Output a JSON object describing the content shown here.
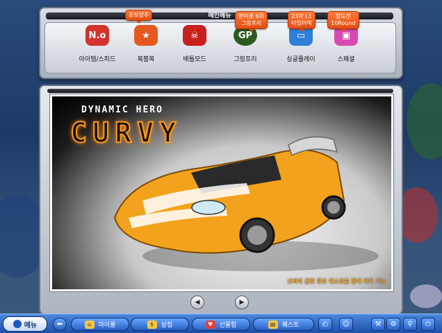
{
  "menu": {
    "title": "메인메뉴",
    "modes": [
      {
        "label": "아이템/스피드",
        "icon": "no-sign-icon",
        "color": "#d2342c"
      },
      {
        "label": "복불복",
        "icon": "pinata-icon",
        "color": "#e45a1e"
      },
      {
        "label": "배틀모드",
        "icon": "pirate-icon",
        "color": "#c7201e"
      },
      {
        "label": "그랑프리",
        "icon": "gp-badge-icon",
        "color": "#2d5a1e"
      },
      {
        "label": "싱글플레이",
        "icon": "monitor-icon",
        "color": "#2f80d8"
      },
      {
        "label": "스페셜",
        "icon": "tv-icon",
        "color": "#d94ab0"
      }
    ],
    "callouts": [
      {
        "text": "초보강추"
      },
      {
        "text": "변이롯 6차\n그랑프리"
      },
      {
        "text": "23차 L1\n타임어택"
      },
      {
        "text": "컬도전\n10Round"
      }
    ]
  },
  "poster": {
    "subtitle": "DYNAMIC HERO",
    "name": "CURVY",
    "caption": "신비의 금빛 큐브 퀘스트를 통해 획득 가능"
  },
  "navigation": {
    "prev_icon": "◀",
    "next_icon": "▶"
  },
  "bottom_bar": {
    "menu_label": "메뉴",
    "my_room": "마이룸",
    "shop": "상점",
    "gift_box": "선물함",
    "quest": "퀘스트"
  },
  "colors": {
    "accent_orange": "#ff8a1e",
    "bar_blue": "#2861c5"
  }
}
